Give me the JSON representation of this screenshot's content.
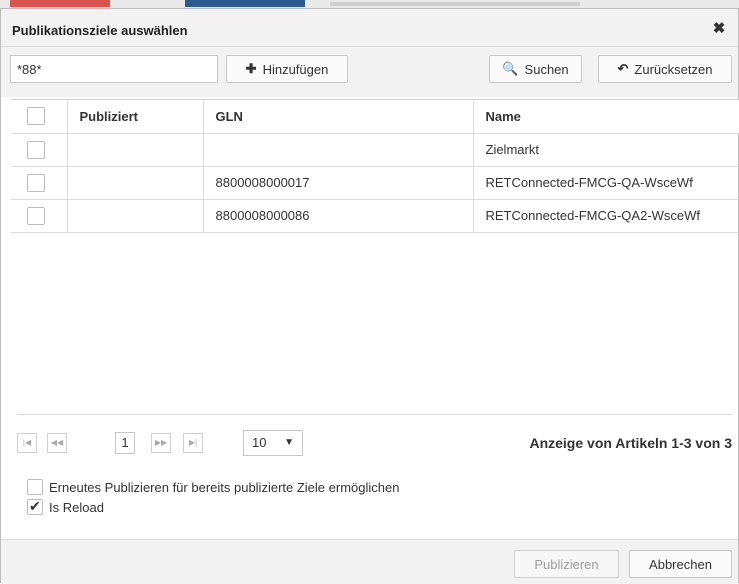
{
  "dialog": {
    "title": "Publikationsziele auswählen",
    "close_icon": "close-icon"
  },
  "toolbar": {
    "search_value": "*88*",
    "add_label": "Hinzufügen",
    "search_label": "Suchen",
    "reset_label": "Zurücksetzen"
  },
  "table": {
    "headers": [
      "Publiziert",
      "GLN",
      "Name"
    ],
    "rows": [
      {
        "publiziert": "",
        "gln": "",
        "name": "Zielmarkt"
      },
      {
        "publiziert": "",
        "gln": "8800008000017",
        "name": "RETConnected-FMCG-QA-WsceWf"
      },
      {
        "publiziert": "",
        "gln": "8800008000086",
        "name": "RETConnected-FMCG-QA2-WsceWf"
      }
    ]
  },
  "pager": {
    "page": "1",
    "page_size": "10",
    "info": "Anzeige von Artikeln 1-3 von 3"
  },
  "options": {
    "republish_label": "Erneutes Publizieren für bereits publizierte Ziele ermöglichen",
    "republish_checked": false,
    "reload_label": "Is Reload",
    "reload_checked": true
  },
  "footer": {
    "publish_label": "Publizieren",
    "cancel_label": "Abbrechen"
  }
}
